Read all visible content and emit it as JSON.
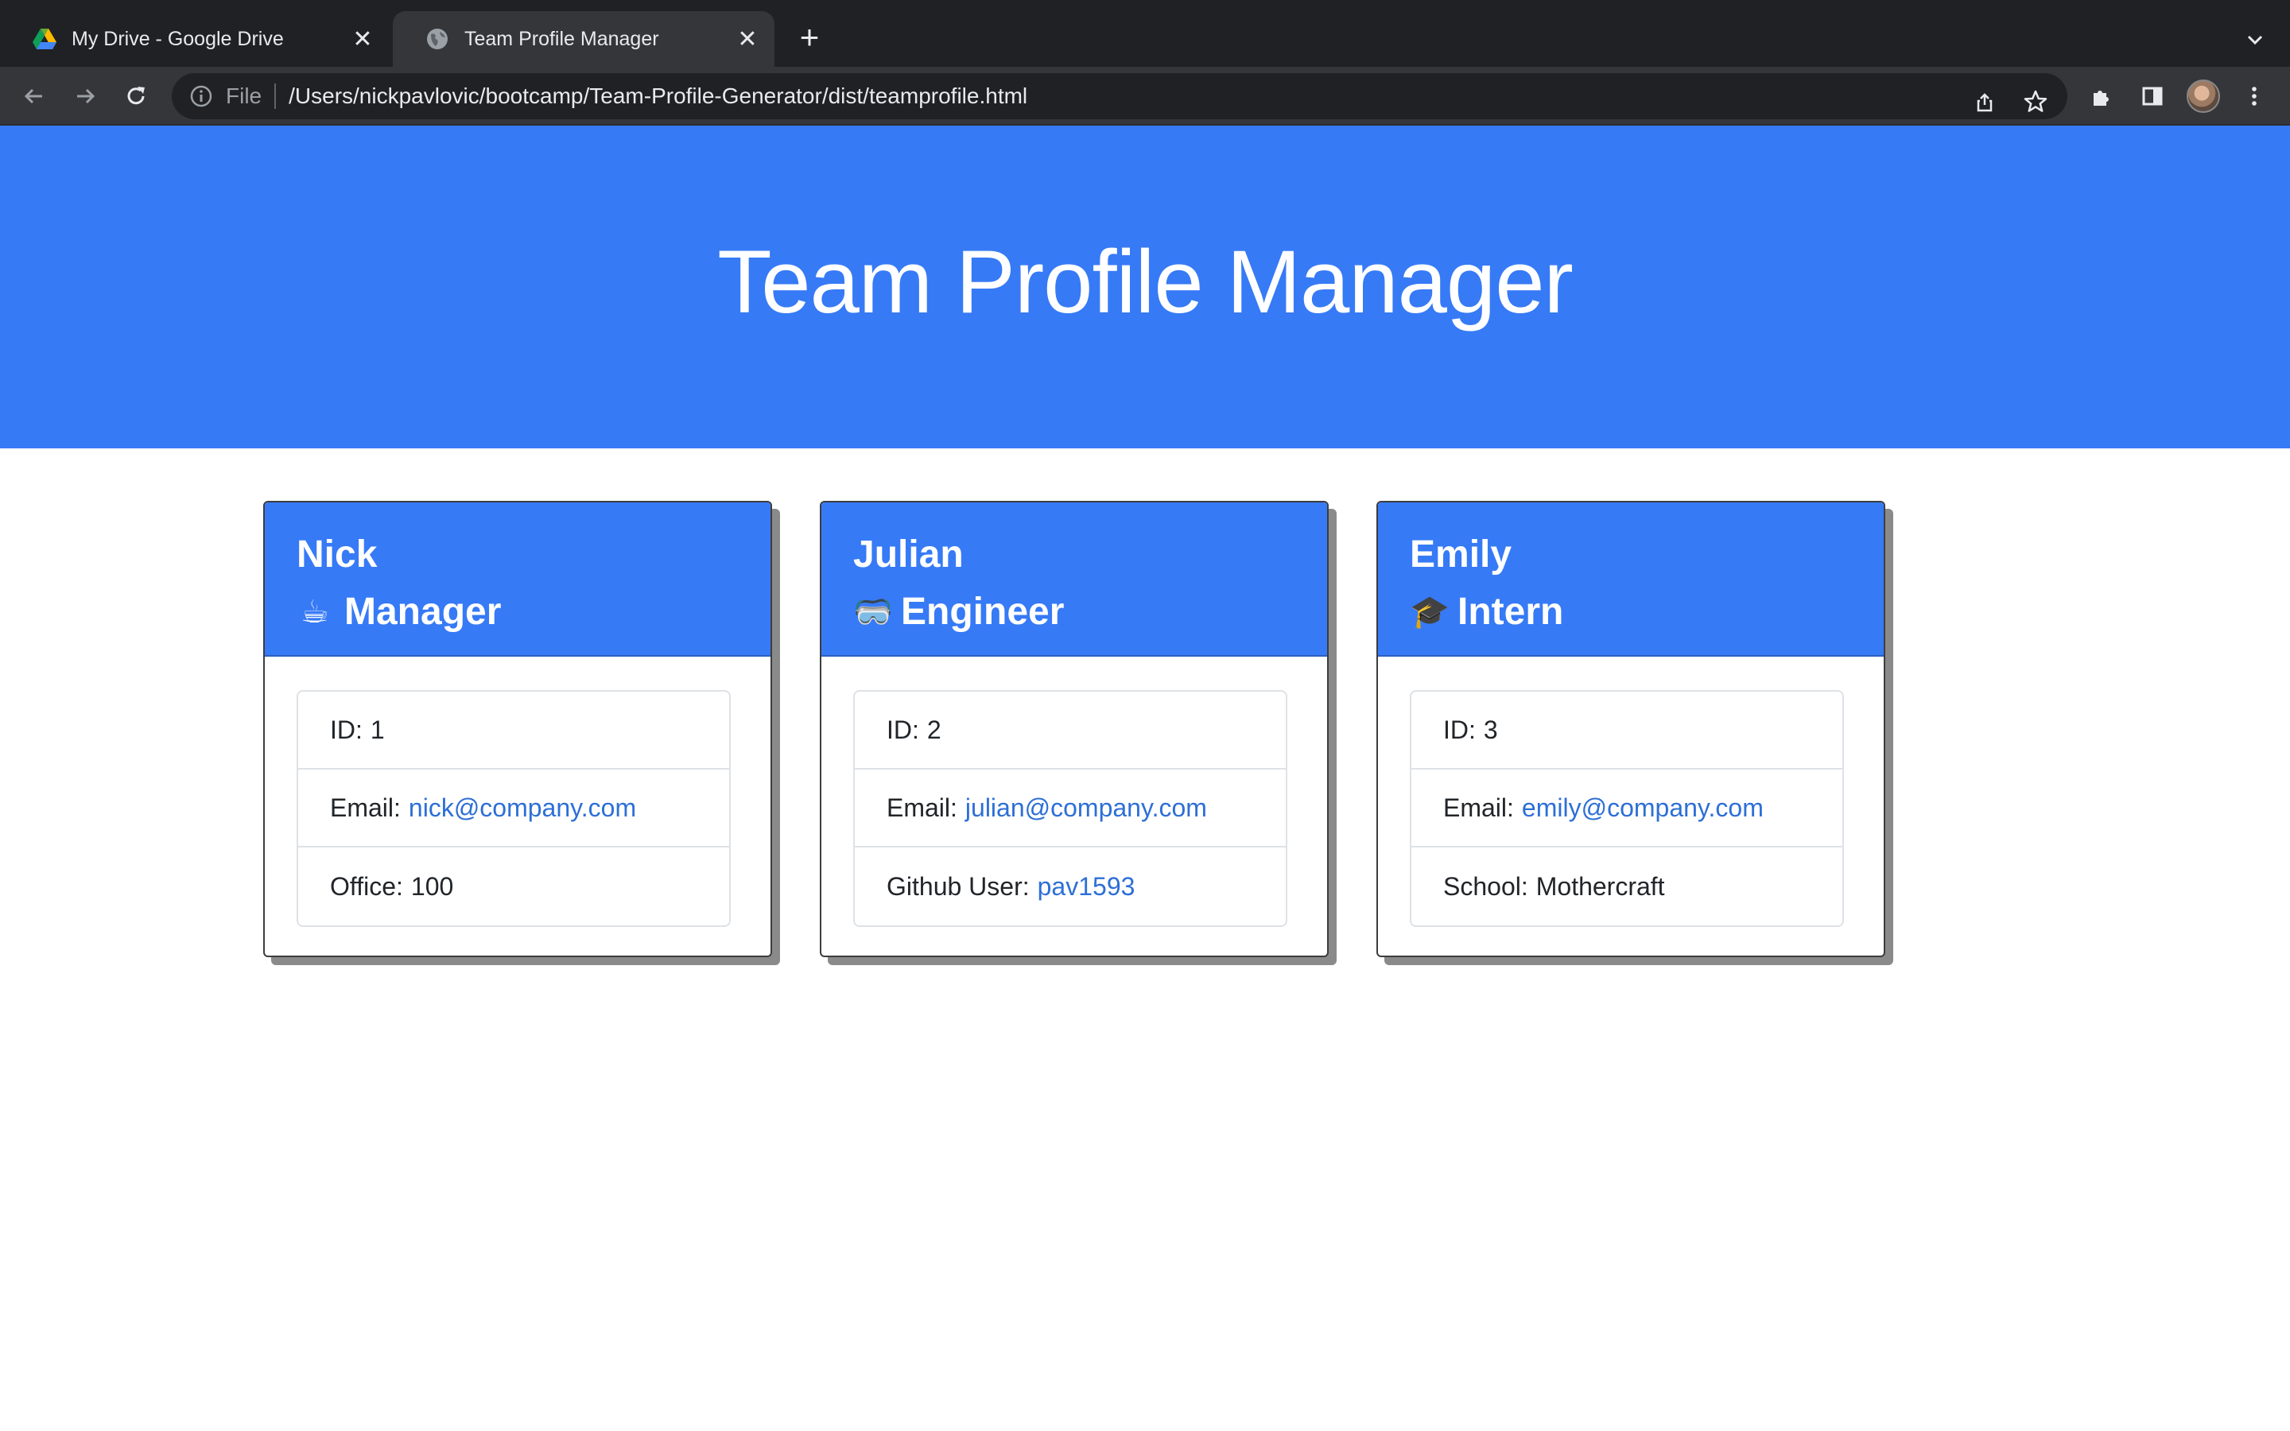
{
  "browser": {
    "tabs": [
      {
        "title": "My Drive - Google Drive",
        "icon": "google-drive-icon",
        "active": false
      },
      {
        "title": "Team Profile Manager",
        "icon": "globe-icon",
        "active": true
      }
    ],
    "address_scheme": "File",
    "address_url": "/Users/nickpavlovic/bootcamp/Team-Profile-Generator/dist/teamprofile.html"
  },
  "page": {
    "title": "Team Profile Manager",
    "accent_color": "#367af6",
    "link_color": "#2d6fd6"
  },
  "cards": [
    {
      "name": "Nick",
      "role": "Manager",
      "role_icon": "☕",
      "id_label": "ID:",
      "id_value": "1",
      "email_label": "Email:",
      "email_value": "nick@company.com",
      "extra_label": "Office:",
      "extra_value": "100"
    },
    {
      "name": "Julian",
      "role": "Engineer",
      "role_icon": "🥽",
      "id_label": "ID:",
      "id_value": "2",
      "email_label": "Email:",
      "email_value": "julian@company.com",
      "extra_label": "Github User:",
      "extra_value": "pav1593"
    },
    {
      "name": "Emily",
      "role": "Intern",
      "role_icon": "🎓",
      "id_label": "ID:",
      "id_value": "3",
      "email_label": "Email:",
      "email_value": "emily@company.com",
      "extra_label": "School:",
      "extra_value": "Mothercraft"
    }
  ]
}
